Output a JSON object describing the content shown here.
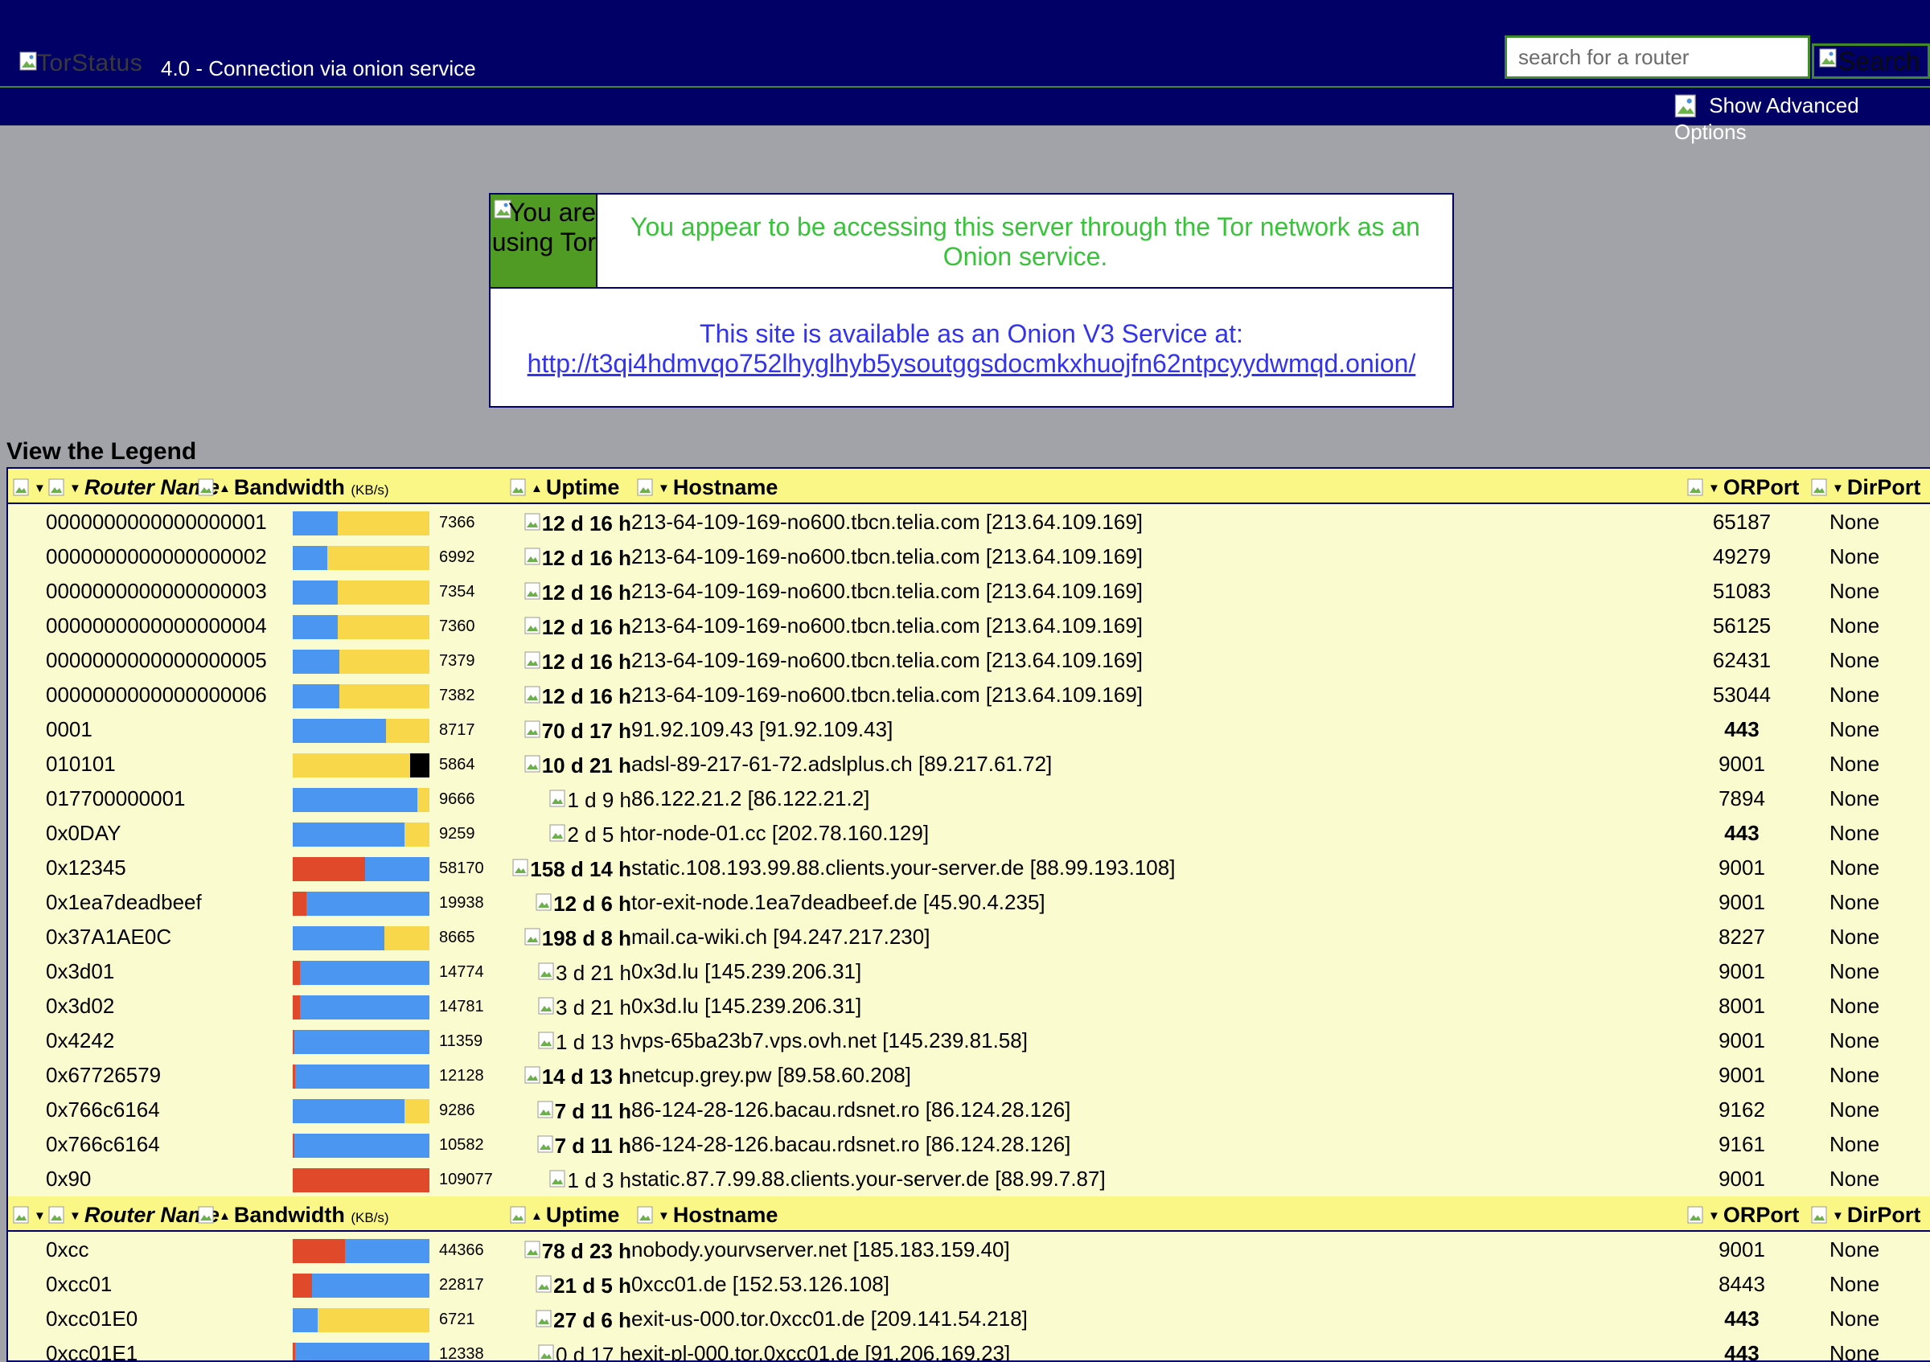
{
  "header": {
    "logo_alt": "TorStatus",
    "tagline": "4.0 - Connection via onion service",
    "search_placeholder": "search for a router",
    "search_button": "Search",
    "advanced_options": "Show Advanced Options"
  },
  "notice": {
    "icon_alt": "You are using Tor",
    "message": "You appear to be accessing this server through the Tor network as an Onion service.",
    "onion_text": "This site is available as an Onion V3 Service at:",
    "onion_url": "http://t3qi4hdmvqo752lhyglhyb5ysoutggsdocmkxhuojfn62ntpcyydwmqd.onion/"
  },
  "legend_link": "View the Legend",
  "table": {
    "columns": {
      "router_name": "Router Name",
      "bandwidth": "Bandwidth",
      "bandwidth_unit": "(KB/s)",
      "uptime": "Uptime",
      "hostname": "Hostname",
      "orport": "ORPort",
      "dirport": "DirPort"
    },
    "colors": {
      "header_bg": "#fbf787",
      "row_bg": "#fbfbd0",
      "blue": "#4a96f0",
      "yellow": "#f8d84a",
      "red": "#e04a2a",
      "black": "#000000"
    },
    "rows": [
      {
        "name": "0000000000000000001",
        "bw": "7366",
        "bar": {
          "red": 0,
          "blue": 0.33,
          "yellow": 0.67,
          "black": 0
        },
        "uptime": "12 d 16 h",
        "up_bold": true,
        "host": "213-64-109-169-no600.tbcn.telia.com [213.64.109.169]",
        "orport": "65187",
        "or_bold": false,
        "dirport": "None"
      },
      {
        "name": "0000000000000000002",
        "bw": "6992",
        "bar": {
          "red": 0,
          "blue": 0.25,
          "yellow": 0.75,
          "black": 0
        },
        "uptime": "12 d 16 h",
        "up_bold": true,
        "host": "213-64-109-169-no600.tbcn.telia.com [213.64.109.169]",
        "orport": "49279",
        "or_bold": false,
        "dirport": "None"
      },
      {
        "name": "0000000000000000003",
        "bw": "7354",
        "bar": {
          "red": 0,
          "blue": 0.33,
          "yellow": 0.67,
          "black": 0
        },
        "uptime": "12 d 16 h",
        "up_bold": true,
        "host": "213-64-109-169-no600.tbcn.telia.com [213.64.109.169]",
        "orport": "51083",
        "or_bold": false,
        "dirport": "None"
      },
      {
        "name": "0000000000000000004",
        "bw": "7360",
        "bar": {
          "red": 0,
          "blue": 0.33,
          "yellow": 0.67,
          "black": 0
        },
        "uptime": "12 d 16 h",
        "up_bold": true,
        "host": "213-64-109-169-no600.tbcn.telia.com [213.64.109.169]",
        "orport": "56125",
        "or_bold": false,
        "dirport": "None"
      },
      {
        "name": "0000000000000000005",
        "bw": "7379",
        "bar": {
          "red": 0,
          "blue": 0.34,
          "yellow": 0.66,
          "black": 0
        },
        "uptime": "12 d 16 h",
        "up_bold": true,
        "host": "213-64-109-169-no600.tbcn.telia.com [213.64.109.169]",
        "orport": "62431",
        "or_bold": false,
        "dirport": "None"
      },
      {
        "name": "0000000000000000006",
        "bw": "7382",
        "bar": {
          "red": 0,
          "blue": 0.34,
          "yellow": 0.66,
          "black": 0
        },
        "uptime": "12 d 16 h",
        "up_bold": true,
        "host": "213-64-109-169-no600.tbcn.telia.com [213.64.109.169]",
        "orport": "53044",
        "or_bold": false,
        "dirport": "None"
      },
      {
        "name": "0001",
        "bw": "8717",
        "bar": {
          "red": 0,
          "blue": 0.68,
          "yellow": 0.32,
          "black": 0
        },
        "uptime": "70 d 17 h",
        "up_bold": true,
        "host": "91.92.109.43 [91.92.109.43]",
        "orport": "443",
        "or_bold": true,
        "dirport": "None"
      },
      {
        "name": "010101",
        "bw": "5864",
        "bar": {
          "red": 0,
          "blue": 0,
          "yellow": 0.86,
          "black": 0.14
        },
        "uptime": "10 d 21 h",
        "up_bold": true,
        "host": "adsl-89-217-61-72.adslplus.ch [89.217.61.72]",
        "orport": "9001",
        "or_bold": false,
        "dirport": "None"
      },
      {
        "name": "017700000001",
        "bw": "9666",
        "bar": {
          "red": 0,
          "blue": 0.91,
          "yellow": 0.09,
          "black": 0
        },
        "uptime": "1 d 9 h",
        "up_bold": false,
        "host": "86.122.21.2 [86.122.21.2]",
        "orport": "7894",
        "or_bold": false,
        "dirport": "None"
      },
      {
        "name": "0x0DAY",
        "bw": "9259",
        "bar": {
          "red": 0,
          "blue": 0.82,
          "yellow": 0.18,
          "black": 0
        },
        "uptime": "2 d 5 h",
        "up_bold": false,
        "host": "tor-node-01.cc [202.78.160.129]",
        "orport": "443",
        "or_bold": true,
        "dirport": "None"
      },
      {
        "name": "0x12345",
        "bw": "58170",
        "bar": {
          "red": 0.53,
          "blue": 0.47,
          "yellow": 0,
          "black": 0
        },
        "uptime": "158 d 14 h",
        "up_bold": true,
        "host": "static.108.193.99.88.clients.your-server.de [88.99.193.108]",
        "orport": "9001",
        "or_bold": false,
        "dirport": "None"
      },
      {
        "name": "0x1ea7deadbeef",
        "bw": "19938",
        "bar": {
          "red": 0.1,
          "blue": 0.9,
          "yellow": 0,
          "black": 0
        },
        "uptime": "12 d 6 h",
        "up_bold": true,
        "host": "tor-exit-node.1ea7deadbeef.de [45.90.4.235]",
        "orport": "9001",
        "or_bold": false,
        "dirport": "None"
      },
      {
        "name": "0x37A1AE0C",
        "bw": "8665",
        "bar": {
          "red": 0,
          "blue": 0.67,
          "yellow": 0.33,
          "black": 0
        },
        "uptime": "198 d 8 h",
        "up_bold": true,
        "host": "mail.ca-wiki.ch [94.247.217.230]",
        "orport": "8227",
        "or_bold": false,
        "dirport": "None"
      },
      {
        "name": "0x3d01",
        "bw": "14774",
        "bar": {
          "red": 0.05,
          "blue": 0.95,
          "yellow": 0,
          "black": 0
        },
        "uptime": "3 d 21 h",
        "up_bold": false,
        "host": "0x3d.lu [145.239.206.31]",
        "orport": "9001",
        "or_bold": false,
        "dirport": "None"
      },
      {
        "name": "0x3d02",
        "bw": "14781",
        "bar": {
          "red": 0.05,
          "blue": 0.95,
          "yellow": 0,
          "black": 0
        },
        "uptime": "3 d 21 h",
        "up_bold": false,
        "host": "0x3d.lu [145.239.206.31]",
        "orport": "8001",
        "or_bold": false,
        "dirport": "None"
      },
      {
        "name": "0x4242",
        "bw": "11359",
        "bar": {
          "red": 0.01,
          "blue": 0.99,
          "yellow": 0,
          "black": 0
        },
        "uptime": "1 d 13 h",
        "up_bold": false,
        "host": "vps-65ba23b7.vps.ovh.net [145.239.81.58]",
        "orport": "9001",
        "or_bold": false,
        "dirport": "None"
      },
      {
        "name": "0x67726579",
        "bw": "12128",
        "bar": {
          "red": 0.02,
          "blue": 0.98,
          "yellow": 0,
          "black": 0
        },
        "uptime": "14 d 13 h",
        "up_bold": true,
        "host": "netcup.grey.pw [89.58.60.208]",
        "orport": "9001",
        "or_bold": false,
        "dirport": "None"
      },
      {
        "name": "0x766c6164",
        "bw": "9286",
        "bar": {
          "red": 0,
          "blue": 0.82,
          "yellow": 0.18,
          "black": 0
        },
        "uptime": "7 d 11 h",
        "up_bold": true,
        "host": "86-124-28-126.bacau.rdsnet.ro [86.124.28.126]",
        "orport": "9162",
        "or_bold": false,
        "dirport": "None"
      },
      {
        "name": "0x766c6164",
        "bw": "10582",
        "bar": {
          "red": 0.01,
          "blue": 0.99,
          "yellow": 0,
          "black": 0
        },
        "uptime": "7 d 11 h",
        "up_bold": true,
        "host": "86-124-28-126.bacau.rdsnet.ro [86.124.28.126]",
        "orport": "9161",
        "or_bold": false,
        "dirport": "None"
      },
      {
        "name": "0x90",
        "bw": "109077",
        "bar": {
          "red": 1,
          "blue": 0,
          "yellow": 0,
          "black": 0
        },
        "uptime": "1 d 3 h",
        "up_bold": false,
        "host": "static.87.7.99.88.clients.your-server.de [88.99.7.87]",
        "orport": "9001",
        "or_bold": false,
        "dirport": "None"
      },
      {
        "name": "0xcc",
        "bw": "44366",
        "bar": {
          "red": 0.38,
          "blue": 0.62,
          "yellow": 0,
          "black": 0
        },
        "uptime": "78 d 23 h",
        "up_bold": true,
        "host": "nobody.yourvserver.net [185.183.159.40]",
        "orport": "9001",
        "or_bold": false,
        "dirport": "None"
      },
      {
        "name": "0xcc01",
        "bw": "22817",
        "bar": {
          "red": 0.14,
          "blue": 0.86,
          "yellow": 0,
          "black": 0
        },
        "uptime": "21 d 5 h",
        "up_bold": true,
        "host": "0xcc01.de [152.53.126.108]",
        "orport": "8443",
        "or_bold": false,
        "dirport": "None"
      },
      {
        "name": "0xcc01E0",
        "bw": "6721",
        "bar": {
          "red": 0,
          "blue": 0.18,
          "yellow": 0.82,
          "black": 0
        },
        "uptime": "27 d 6 h",
        "up_bold": true,
        "host": "exit-us-000.tor.0xcc01.de [209.141.54.218]",
        "orport": "443",
        "or_bold": true,
        "dirport": "None"
      },
      {
        "name": "0xcc01E1",
        "bw": "12338",
        "bar": {
          "red": 0.02,
          "blue": 0.98,
          "yellow": 0,
          "black": 0
        },
        "uptime": "0 d 17 h",
        "up_bold": false,
        "host": "exit-pl-000.tor.0xcc01.de [91.206.169.23]",
        "orport": "443",
        "or_bold": true,
        "dirport": "None"
      }
    ]
  }
}
